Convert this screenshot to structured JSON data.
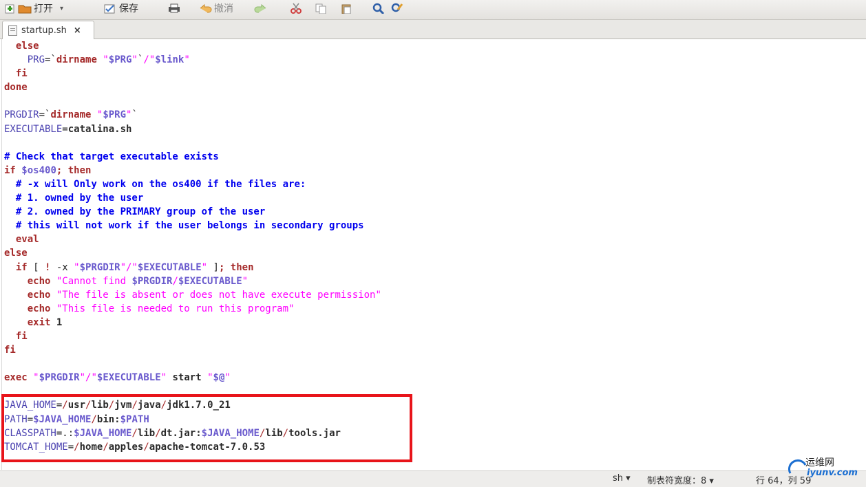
{
  "toolbar": {
    "open_label": "打开",
    "save_label": "保存",
    "undo_label": "撤消"
  },
  "tab": {
    "title": "startup.sh",
    "close": "×"
  },
  "code_lines": [
    [
      [
        "kw",
        "  else"
      ]
    ],
    [
      [
        "t",
        "    "
      ],
      [
        "vn",
        "PRG"
      ],
      [
        "t",
        "=`"
      ],
      [
        "kw",
        "dirname"
      ],
      [
        "t",
        " "
      ],
      [
        "str",
        "\""
      ],
      [
        "var",
        "$PRG"
      ],
      [
        "str",
        "\""
      ],
      [
        "t",
        "`"
      ],
      [
        "str",
        "/\""
      ],
      [
        "var",
        "$link"
      ],
      [
        "str",
        "\""
      ]
    ],
    [
      [
        "kw",
        "  fi"
      ]
    ],
    [
      [
        "kw",
        "done"
      ]
    ],
    [],
    [
      [
        "vn",
        "PRGDIR"
      ],
      [
        "t",
        "=`"
      ],
      [
        "kw",
        "dirname"
      ],
      [
        "t",
        " "
      ],
      [
        "str",
        "\""
      ],
      [
        "var",
        "$PRG"
      ],
      [
        "str",
        "\""
      ],
      [
        "t",
        "`"
      ]
    ],
    [
      [
        "vn",
        "EXECUTABLE"
      ],
      [
        "t",
        "="
      ],
      [
        "id",
        "catalina.sh"
      ]
    ],
    [],
    [
      [
        "cmt",
        "# Check that target executable exists"
      ]
    ],
    [
      [
        "kw",
        "if"
      ],
      [
        "t",
        " "
      ],
      [
        "var",
        "$os400"
      ],
      [
        "kw",
        "; then"
      ]
    ],
    [
      [
        "t",
        "  "
      ],
      [
        "cmt",
        "# -x will Only work on the os400 if the files are:"
      ]
    ],
    [
      [
        "t",
        "  "
      ],
      [
        "cmt",
        "# 1. owned by the user"
      ]
    ],
    [
      [
        "t",
        "  "
      ],
      [
        "cmt",
        "# 2. owned by the PRIMARY group of the user"
      ]
    ],
    [
      [
        "t",
        "  "
      ],
      [
        "cmt",
        "# this will not work if the user belongs in secondary groups"
      ]
    ],
    [
      [
        "kw",
        "  eval"
      ]
    ],
    [
      [
        "kw",
        "else"
      ]
    ],
    [
      [
        "kw",
        "  if"
      ],
      [
        "t",
        " [ "
      ],
      [
        "kw",
        "!"
      ],
      [
        "t",
        " -x "
      ],
      [
        "str",
        "\""
      ],
      [
        "var",
        "$PRGDIR"
      ],
      [
        "str",
        "\"/\""
      ],
      [
        "var",
        "$EXECUTABLE"
      ],
      [
        "str",
        "\""
      ],
      [
        "t",
        " ]"
      ],
      [
        "kw",
        "; then"
      ]
    ],
    [
      [
        "kw",
        "    echo"
      ],
      [
        "t",
        " "
      ],
      [
        "str",
        "\"Cannot find "
      ],
      [
        "var",
        "$PRGDIR"
      ],
      [
        "str",
        "/"
      ],
      [
        "var",
        "$EXECUTABLE"
      ],
      [
        "str",
        "\""
      ]
    ],
    [
      [
        "kw",
        "    echo"
      ],
      [
        "t",
        " "
      ],
      [
        "str",
        "\"The file is absent or does not have execute permission\""
      ]
    ],
    [
      [
        "kw",
        "    echo"
      ],
      [
        "t",
        " "
      ],
      [
        "str",
        "\"This file is needed to run this program\""
      ]
    ],
    [
      [
        "kw",
        "    exit"
      ],
      [
        "id",
        " 1"
      ]
    ],
    [
      [
        "kw",
        "  fi"
      ]
    ],
    [
      [
        "kw",
        "fi"
      ]
    ],
    [],
    [
      [
        "kw",
        "exec"
      ],
      [
        "t",
        " "
      ],
      [
        "str",
        "\""
      ],
      [
        "var",
        "$PRGDIR"
      ],
      [
        "str",
        "\"/\""
      ],
      [
        "var",
        "$EXECUTABLE"
      ],
      [
        "str",
        "\""
      ],
      [
        "t",
        " "
      ],
      [
        "id",
        "start"
      ],
      [
        "t",
        " "
      ],
      [
        "str",
        "\""
      ],
      [
        "var",
        "$@"
      ],
      [
        "str",
        "\""
      ]
    ],
    [],
    [
      [
        "vn",
        "JAVA_HOME"
      ],
      [
        "t",
        "="
      ],
      [
        "op",
        "/"
      ],
      [
        "id",
        "usr"
      ],
      [
        "op",
        "/"
      ],
      [
        "id",
        "lib"
      ],
      [
        "op",
        "/"
      ],
      [
        "id",
        "jvm"
      ],
      [
        "op",
        "/"
      ],
      [
        "id",
        "java"
      ],
      [
        "op",
        "/"
      ],
      [
        "id",
        "jdk1.7.0_21"
      ]
    ],
    [
      [
        "vn",
        "PATH"
      ],
      [
        "t",
        "="
      ],
      [
        "var",
        "$JAVA_HOME"
      ],
      [
        "op",
        "/"
      ],
      [
        "id",
        "bin:"
      ],
      [
        "var",
        "$PATH"
      ]
    ],
    [
      [
        "vn",
        "CLASSPATH"
      ],
      [
        "t",
        "=.:"
      ],
      [
        "var",
        "$JAVA_HOME"
      ],
      [
        "op",
        "/"
      ],
      [
        "id",
        "lib"
      ],
      [
        "op",
        "/"
      ],
      [
        "id",
        "dt.jar:"
      ],
      [
        "var",
        "$JAVA_HOME"
      ],
      [
        "op",
        "/"
      ],
      [
        "id",
        "lib"
      ],
      [
        "op",
        "/"
      ],
      [
        "id",
        "tools.jar"
      ]
    ],
    [
      [
        "vn",
        "TOMCAT_HOME"
      ],
      [
        "t",
        "="
      ],
      [
        "op",
        "/"
      ],
      [
        "id",
        "home"
      ],
      [
        "op",
        "/"
      ],
      [
        "id",
        "apples"
      ],
      [
        "op",
        "/"
      ],
      [
        "id",
        "apache-tomcat-7.0.53"
      ]
    ]
  ],
  "statusbar": {
    "lang": "sh ▾",
    "tab_width": "制表符宽度：8 ▾",
    "position": "行 64，列 59"
  },
  "watermark": {
    "line1": "运维网",
    "line2": "iyunv.com"
  }
}
